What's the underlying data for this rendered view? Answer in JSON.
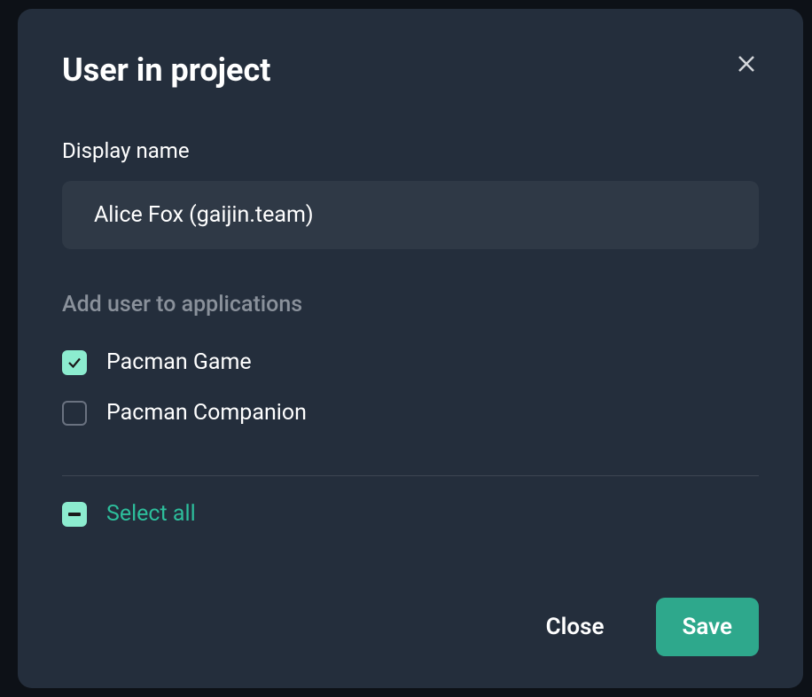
{
  "modal": {
    "title": "User in project",
    "display_name_label": "Display name",
    "display_name_value": "Alice Fox (gaijin.team)",
    "applications_label": "Add user to applications",
    "applications": [
      {
        "label": "Pacman Game",
        "checked": true
      },
      {
        "label": "Pacman Companion",
        "checked": false
      }
    ],
    "select_all_label": "Select all",
    "select_all_state": "indeterminate",
    "close_label": "Close",
    "save_label": "Save"
  }
}
